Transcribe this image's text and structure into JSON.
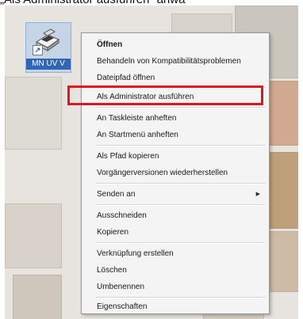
{
  "caption": "„Als Administrator ausführen“ anwä",
  "desktop_icon": {
    "label": "MN UV V"
  },
  "context_menu": {
    "items": [
      {
        "label": "Öffnen"
      },
      {
        "label": "Behandeln von Kompatibilitätsproblemen"
      },
      {
        "label": "Dateipfad öffnen"
      },
      {
        "label": "Als Administrator ausführen"
      },
      {
        "label": "An Taskleiste anheften"
      },
      {
        "label": "An Startmenü anheften"
      },
      {
        "label": "Als Pfad kopieren"
      },
      {
        "label": "Vorgängerversionen wiederherstellen"
      },
      {
        "label": "Senden an"
      },
      {
        "label": "Ausschneiden"
      },
      {
        "label": "Kopieren"
      },
      {
        "label": "Verknüpfung erstellen"
      },
      {
        "label": "Löschen"
      },
      {
        "label": "Umbenennen"
      },
      {
        "label": "Eigenschaften"
      }
    ]
  },
  "colors": {
    "highlight_border": "#e01422",
    "menu_background": "#f4f4f4"
  },
  "icons": {
    "submenu": "chevron-right-icon",
    "desktop_program": "scanner-icon",
    "shortcut": "shortcut-arrow-icon"
  }
}
